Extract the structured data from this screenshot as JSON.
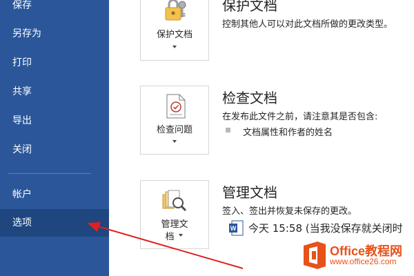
{
  "sidebar": {
    "items": [
      {
        "label": "保存"
      },
      {
        "label": "另存为"
      },
      {
        "label": "打印"
      },
      {
        "label": "共享"
      },
      {
        "label": "导出"
      },
      {
        "label": "关闭"
      },
      {
        "label": "帐户"
      },
      {
        "label": "选项"
      }
    ],
    "selected": "选项"
  },
  "sections": {
    "protect": {
      "button_label": "保护文档",
      "title": "保护文档",
      "description": "控制其他人可以对此文档所做的更改类型。"
    },
    "inspect": {
      "button_label": "检查问题",
      "title": "检查文档",
      "description": "在发布此文件之前，请注意其是否包含:",
      "bullets": [
        "文档属性和作者的姓名"
      ]
    },
    "manage": {
      "button_label_line1": "管理文",
      "button_label_line2": "档",
      "title": "管理文档",
      "description": "签入、签出并恢复未保存的更改。",
      "version_item": "今天 15:58 (当我没保存就关闭时"
    }
  },
  "watermark": {
    "brand": "Office教程网",
    "url": "www.office26.com"
  },
  "colors": {
    "sidebar_bg": "#2b579a",
    "sidebar_selected": "#1f467f",
    "arrow": "#e02020",
    "watermark": "#e8511a"
  }
}
